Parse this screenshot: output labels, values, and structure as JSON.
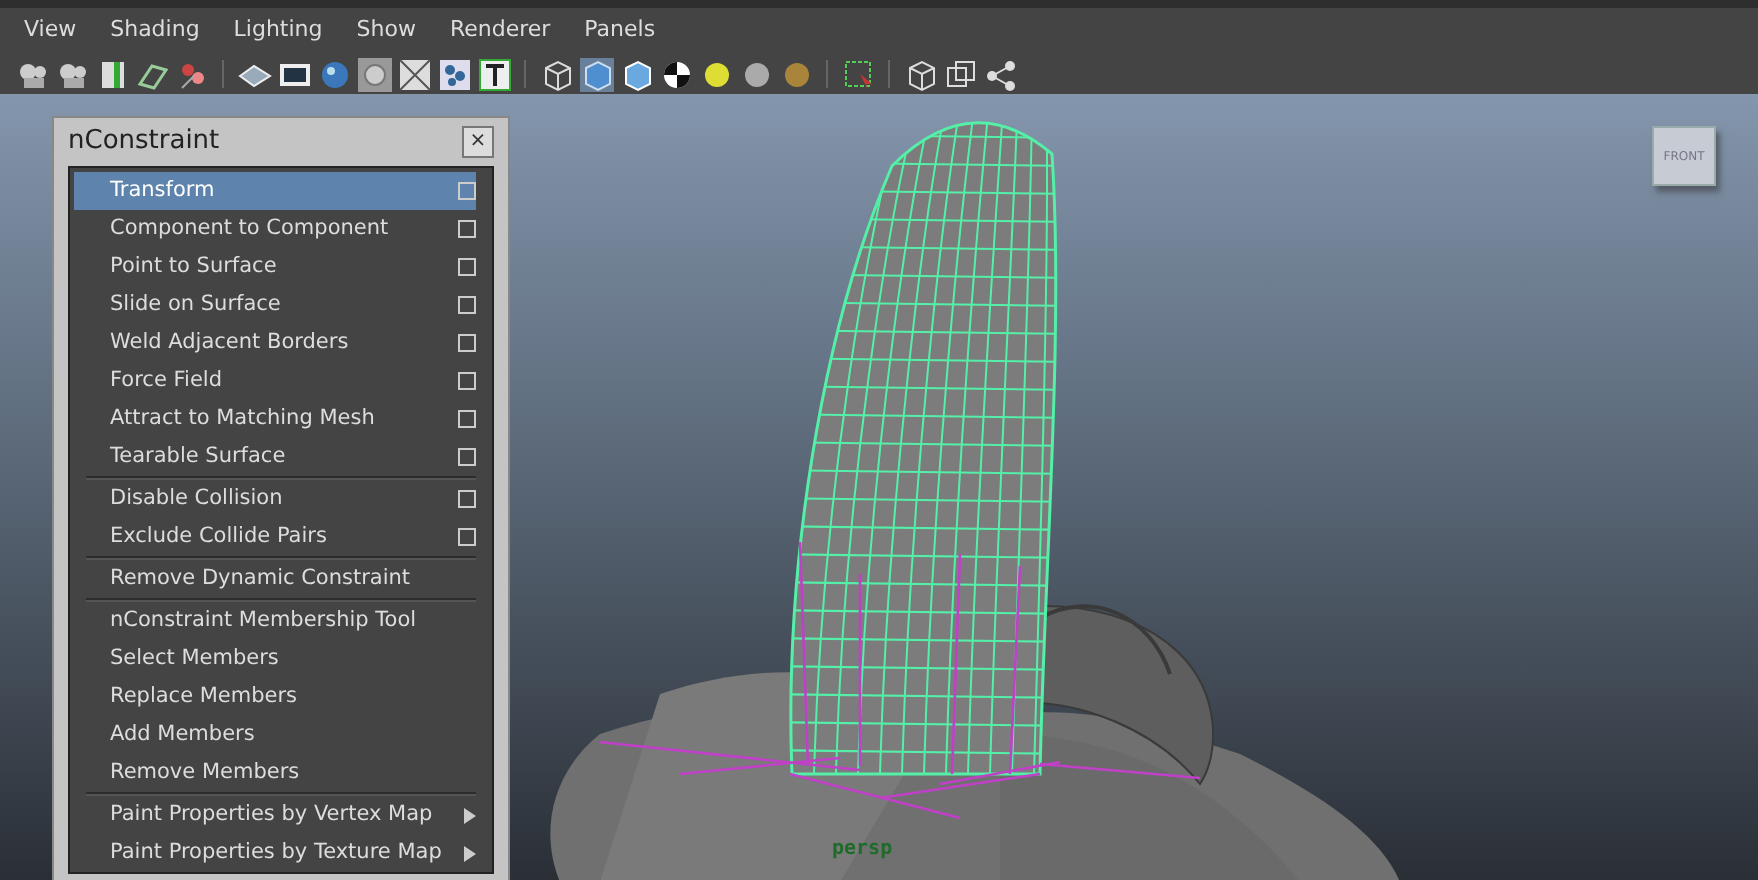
{
  "menu_bar": [
    "View",
    "Shading",
    "Lighting",
    "Show",
    "Renderer",
    "Panels"
  ],
  "viewport": {
    "view_cube_label": "FRONT",
    "camera_label": "persp"
  },
  "constraint_menu": {
    "title": "nConstraint",
    "close": "×",
    "groups": [
      [
        {
          "label": "Transform",
          "kind": "option",
          "selected": true
        },
        {
          "label": "Component to Component",
          "kind": "option",
          "selected": false
        },
        {
          "label": "Point to Surface",
          "kind": "option",
          "selected": false
        },
        {
          "label": "Slide on Surface",
          "kind": "option",
          "selected": false
        },
        {
          "label": "Weld Adjacent Borders",
          "kind": "option",
          "selected": false
        },
        {
          "label": "Force Field",
          "kind": "option",
          "selected": false
        },
        {
          "label": "Attract to Matching Mesh",
          "kind": "option",
          "selected": false
        },
        {
          "label": "Tearable Surface",
          "kind": "option",
          "selected": false
        }
      ],
      [
        {
          "label": "Disable Collision",
          "kind": "option",
          "selected": false
        },
        {
          "label": "Exclude Collide Pairs",
          "kind": "option",
          "selected": false
        }
      ],
      [
        {
          "label": "Remove Dynamic Constraint",
          "kind": "plain",
          "selected": false
        }
      ],
      [
        {
          "label": "nConstraint Membership Tool",
          "kind": "plain",
          "selected": false
        },
        {
          "label": "Select Members",
          "kind": "plain",
          "selected": false
        },
        {
          "label": "Replace Members",
          "kind": "plain",
          "selected": false
        },
        {
          "label": "Add Members",
          "kind": "plain",
          "selected": false
        },
        {
          "label": "Remove Members",
          "kind": "plain",
          "selected": false
        }
      ],
      [
        {
          "label": "Paint Properties by Vertex Map",
          "kind": "submenu",
          "selected": false
        },
        {
          "label": "Paint Properties by Texture Map",
          "kind": "submenu",
          "selected": false
        }
      ]
    ]
  }
}
